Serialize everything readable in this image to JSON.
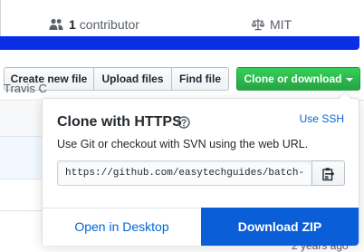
{
  "summary": {
    "contributors_count": "1",
    "contributors_label": "contributor",
    "license": "MIT"
  },
  "toolbar": {
    "create_new_file": "Create new file",
    "upload_files": "Upload files",
    "find_file": "Find file",
    "clone_or_download": "Clone or download"
  },
  "background": {
    "row_text": "Travis C",
    "row_age": "2 years ago"
  },
  "clone_menu": {
    "title": "Clone with HTTPS",
    "use_ssh": "Use SSH",
    "description": "Use Git or checkout with SVN using the web URL.",
    "url": "https://github.com/easytechguides/batch-scripts.git",
    "open_in_desktop": "Open in Desktop",
    "download_zip": "Download ZIP"
  },
  "colors": {
    "clone_button": "#28a745",
    "download_zip": "#0a5ed8",
    "link": "#0366d6",
    "language_bar": "#0a2ee6"
  },
  "icons": {
    "contributors": "people-icon",
    "license": "law-icon",
    "help": "question-icon",
    "copy": "clippy-icon",
    "dropdown": "caret-down-icon"
  }
}
